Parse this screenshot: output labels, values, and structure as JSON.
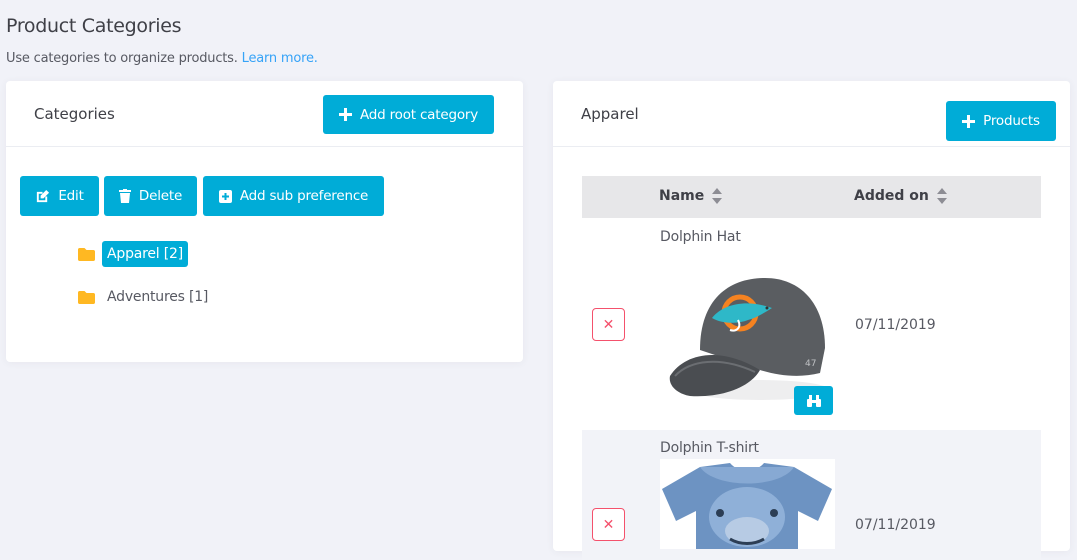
{
  "header": {
    "title": "Product Categories",
    "subtitle": "Use categories to organize products.",
    "learn_more": "Learn more."
  },
  "categories_panel": {
    "title": "Categories",
    "add_root_label": "Add root category",
    "edit_label": "Edit",
    "delete_label": "Delete",
    "add_sub_label": "Add sub preference",
    "tree": [
      {
        "label": "Apparel [2]",
        "selected": true
      },
      {
        "label": "Adventures [1]",
        "selected": false
      }
    ]
  },
  "products_panel": {
    "title": "Apparel",
    "add_products_label": "Products",
    "columns": {
      "name": "Name",
      "added_on": "Added on"
    },
    "rows": [
      {
        "name": "Dolphin Hat",
        "added_on": "07/11/2019"
      },
      {
        "name": "Dolphin T-shirt",
        "added_on": "07/11/2019"
      }
    ]
  },
  "colors": {
    "accent": "#00acd7",
    "danger": "#f4516c",
    "folder": "#ffb822",
    "link": "#36a3f7"
  }
}
